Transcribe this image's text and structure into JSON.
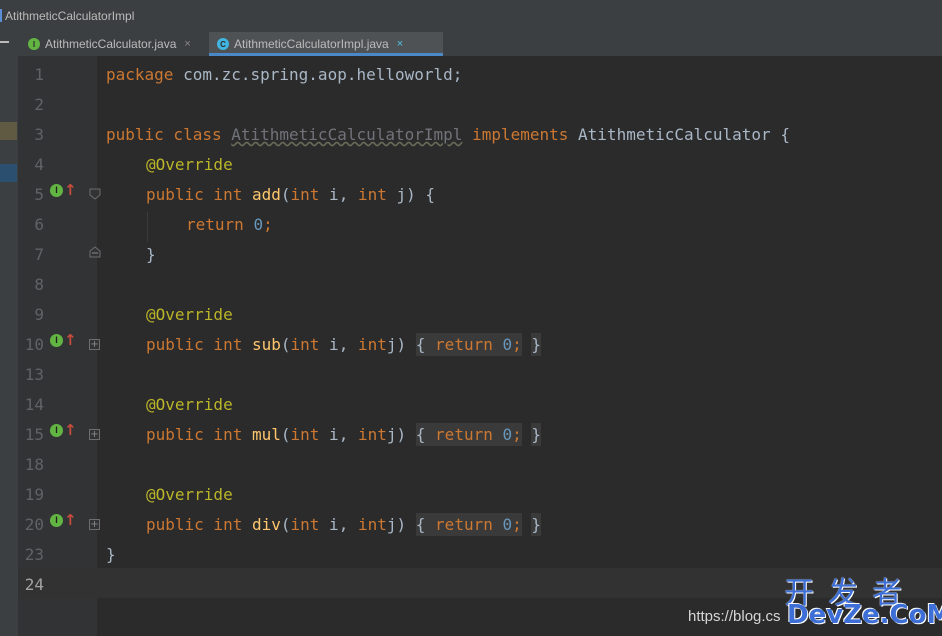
{
  "window": {
    "title": "AtithmeticCalculatorImpl"
  },
  "tabs": [
    {
      "label": "AtithmeticCalculator.java",
      "icon": "interface-icon",
      "icon_letter": "I",
      "active": false,
      "close": "×"
    },
    {
      "label": "AtithmeticCalculatorImpl.java",
      "icon": "class-icon",
      "icon_letter": "C",
      "active": true,
      "close": "×"
    }
  ],
  "gutter": {
    "line_numbers": [
      "1",
      "2",
      "3",
      "4",
      "5",
      "6",
      "7",
      "8",
      "9",
      "10",
      "13",
      "14",
      "15",
      "18",
      "19",
      "20",
      "23",
      "24"
    ],
    "impl_marker_letter": "I",
    "impl_marker_arrow": "↑",
    "fold_collapsed": "+",
    "fold_expanded": "−"
  },
  "code": {
    "l1": {
      "kw": "package",
      "rest": " com.zc.spring.aop.helloworld;"
    },
    "l3": {
      "kw1": "public class",
      "cls": "AtithmeticCalculatorImpl",
      "kw2": "implements",
      "iface": "AtithmeticCalculator {"
    },
    "annotation": "@Override",
    "l5": {
      "kw": "public int",
      "fn": "add",
      "params_open": "(",
      "int1": "int",
      "p1": " i, ",
      "int2": "int",
      "p2": " j) {"
    },
    "l6": {
      "kw": "return",
      "num": "0",
      "semi": ";"
    },
    "l7": "}",
    "sub": {
      "fn": "sub"
    },
    "mul": {
      "fn": "mul"
    },
    "div": {
      "fn": "div"
    },
    "folded": {
      "open": "{",
      "kw": "return",
      "num": "0",
      "semi": ";",
      "close": "}"
    },
    "l23": "}"
  },
  "watermark": {
    "url": "https://blog.cs",
    "logo_top": "开发者",
    "logo_bottom": "DevZe.CoM"
  },
  "colors": {
    "background": "#2b2b2b",
    "keyword": "#cc7832",
    "annotation": "#bbb529",
    "number": "#6897bb",
    "function": "#ffc66d",
    "text": "#a9b7c6"
  }
}
